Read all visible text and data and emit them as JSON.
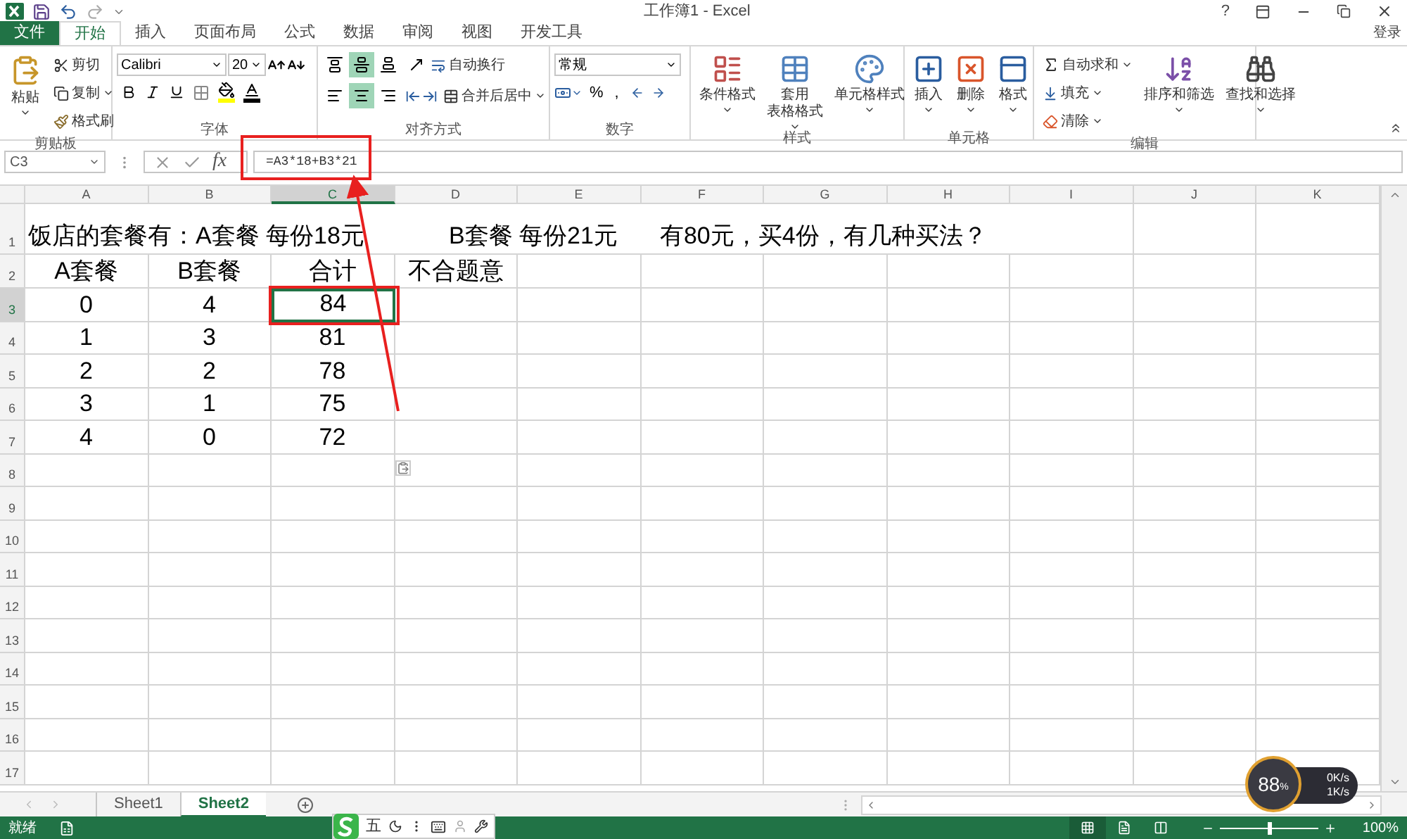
{
  "title_bar": {
    "title": "工作簿1 - Excel",
    "help": "?"
  },
  "ribbon_tabs": [
    {
      "label": "文件",
      "kind": "file",
      "selected": false
    },
    {
      "label": "开始",
      "kind": "tab",
      "selected": true
    },
    {
      "label": "插入",
      "kind": "tab",
      "selected": false
    },
    {
      "label": "页面布局",
      "kind": "tab",
      "selected": false
    },
    {
      "label": "公式",
      "kind": "tab",
      "selected": false
    },
    {
      "label": "数据",
      "kind": "tab",
      "selected": false
    },
    {
      "label": "审阅",
      "kind": "tab",
      "selected": false
    },
    {
      "label": "视图",
      "kind": "tab",
      "selected": false
    },
    {
      "label": "开发工具",
      "kind": "tab",
      "selected": false
    }
  ],
  "account": "登录",
  "clipboard": {
    "label": "剪贴板",
    "paste": "粘贴",
    "cut": "剪切",
    "copy": "复制",
    "painter": "格式刷"
  },
  "font": {
    "label": "字体",
    "name": "Calibri",
    "size": "20"
  },
  "alignment": {
    "label": "对齐方式",
    "wrap": "自动换行",
    "merge": "合并后居中",
    "vertical": [
      {
        "selected": false
      },
      {
        "selected": true
      },
      {
        "selected": false
      }
    ],
    "horizontal": [
      {
        "selected": false
      },
      {
        "selected": true
      },
      {
        "selected": false
      }
    ]
  },
  "number": {
    "label": "数字",
    "format": "常规",
    "percent": "%",
    "comma": ","
  },
  "styles": {
    "label": "样式",
    "buttons": [
      {
        "lines": [
          "条件格式"
        ]
      },
      {
        "lines": [
          "套用",
          "表格格式"
        ]
      },
      {
        "lines": [
          "单元格样式"
        ]
      }
    ]
  },
  "cells": {
    "label": "单元格",
    "buttons": [
      "插入",
      "删除",
      "格式"
    ]
  },
  "editing": {
    "label": "编辑",
    "autosum": "自动求和",
    "fill": "填充",
    "clear": "清除",
    "sort": "排序和筛选",
    "find": "查找和选择"
  },
  "formula_bar": {
    "name_box": "C3",
    "fx": "fx",
    "formula": "=A3*18+B3*21"
  },
  "columns": [
    {
      "label": "A",
      "selected": false
    },
    {
      "label": "B",
      "selected": false
    },
    {
      "label": "C",
      "selected": true
    },
    {
      "label": "D",
      "selected": false
    },
    {
      "label": "E",
      "selected": false
    },
    {
      "label": "F",
      "selected": false
    },
    {
      "label": "G",
      "selected": false
    },
    {
      "label": "H",
      "selected": false
    },
    {
      "label": "I",
      "selected": false
    },
    {
      "label": "J",
      "selected": false
    },
    {
      "label": "K",
      "selected": false
    }
  ],
  "rows": [
    {
      "number": "1",
      "selected": false,
      "spill": [
        "饭店的套餐有：A套餐  每份18元",
        "B套餐  每份21元",
        "有80元，买4份，有几种买法？"
      ]
    },
    {
      "number": "2",
      "selected": false,
      "cells": [
        {
          "text": "A套餐",
          "selected": false
        },
        {
          "text": "B套餐",
          "selected": false
        },
        {
          "text": "合计",
          "selected": false
        },
        {
          "text": "不合题意",
          "selected": false
        }
      ]
    },
    {
      "number": "3",
      "selected": true,
      "cells": [
        {
          "text": "0",
          "selected": false
        },
        {
          "text": "4",
          "selected": false
        },
        {
          "text": "84",
          "selected": true
        }
      ]
    },
    {
      "number": "4",
      "selected": false,
      "cells": [
        {
          "text": "1",
          "selected": false
        },
        {
          "text": "3",
          "selected": false
        },
        {
          "text": "81",
          "selected": false
        }
      ]
    },
    {
      "number": "5",
      "selected": false,
      "cells": [
        {
          "text": "2",
          "selected": false
        },
        {
          "text": "2",
          "selected": false
        },
        {
          "text": "78",
          "selected": false
        }
      ]
    },
    {
      "number": "6",
      "selected": false,
      "cells": [
        {
          "text": "3",
          "selected": false
        },
        {
          "text": "1",
          "selected": false
        },
        {
          "text": "75",
          "selected": false
        }
      ]
    },
    {
      "number": "7",
      "selected": false,
      "cells": [
        {
          "text": "4",
          "selected": false
        },
        {
          "text": "0",
          "selected": false
        },
        {
          "text": "72",
          "selected": false
        }
      ]
    },
    {
      "number": "8",
      "selected": false
    },
    {
      "number": "9",
      "selected": false
    },
    {
      "number": "10",
      "selected": false
    },
    {
      "number": "11",
      "selected": false
    },
    {
      "number": "12",
      "selected": false
    },
    {
      "number": "13",
      "selected": false
    },
    {
      "number": "14",
      "selected": false
    },
    {
      "number": "15",
      "selected": false
    },
    {
      "number": "16",
      "selected": false
    },
    {
      "number": "17",
      "selected": false
    }
  ],
  "sheet_tabs": [
    {
      "label": "Sheet1",
      "selected": false
    },
    {
      "label": "Sheet2",
      "selected": true
    }
  ],
  "status_bar": {
    "status": "就绪",
    "zoom": "100%",
    "zoom_slider": {
      "level": 0.5
    },
    "views": [
      {
        "selected": true
      },
      {
        "selected": false
      },
      {
        "selected": false
      }
    ]
  },
  "ime_bar": {
    "mode": "五"
  },
  "network_monitor": {
    "percent": "88",
    "unit": "%",
    "upload": "0K/s",
    "download": "1K/s"
  }
}
